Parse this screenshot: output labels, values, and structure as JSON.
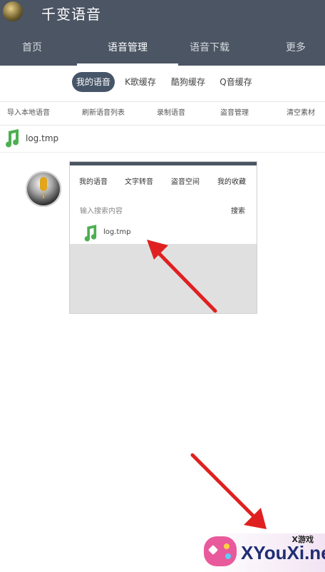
{
  "app": {
    "title": "千变语音",
    "tabs": [
      {
        "label": "首页"
      },
      {
        "label": "语音管理"
      },
      {
        "label": "语音下载"
      },
      {
        "label": "更多"
      }
    ]
  },
  "subtabs": [
    {
      "label": "我的语音"
    },
    {
      "label": "K歌缓存"
    },
    {
      "label": "酷狗缓存"
    },
    {
      "label": "Q音缓存"
    }
  ],
  "actions": [
    {
      "label": "导入本地语音"
    },
    {
      "label": "刷新语音列表"
    },
    {
      "label": "录制语音"
    },
    {
      "label": "盗音管理"
    },
    {
      "label": "清空素材"
    }
  ],
  "file": {
    "name": "log.tmp"
  },
  "panel": {
    "tabs": [
      {
        "label": "我的语音"
      },
      {
        "label": "文字转音"
      },
      {
        "label": "盗音空间"
      },
      {
        "label": "我的收藏"
      }
    ],
    "search_placeholder": "输入搜索内容",
    "search_button": "搜索",
    "file_name": "log.tmp"
  },
  "watermark": {
    "cn": "X游戏",
    "en": "XYouXi.net"
  },
  "colors": {
    "appbar": "#4b5563",
    "active_pill": "#475569",
    "note_green": "#4caf50",
    "arrow_red": "#e02020"
  }
}
